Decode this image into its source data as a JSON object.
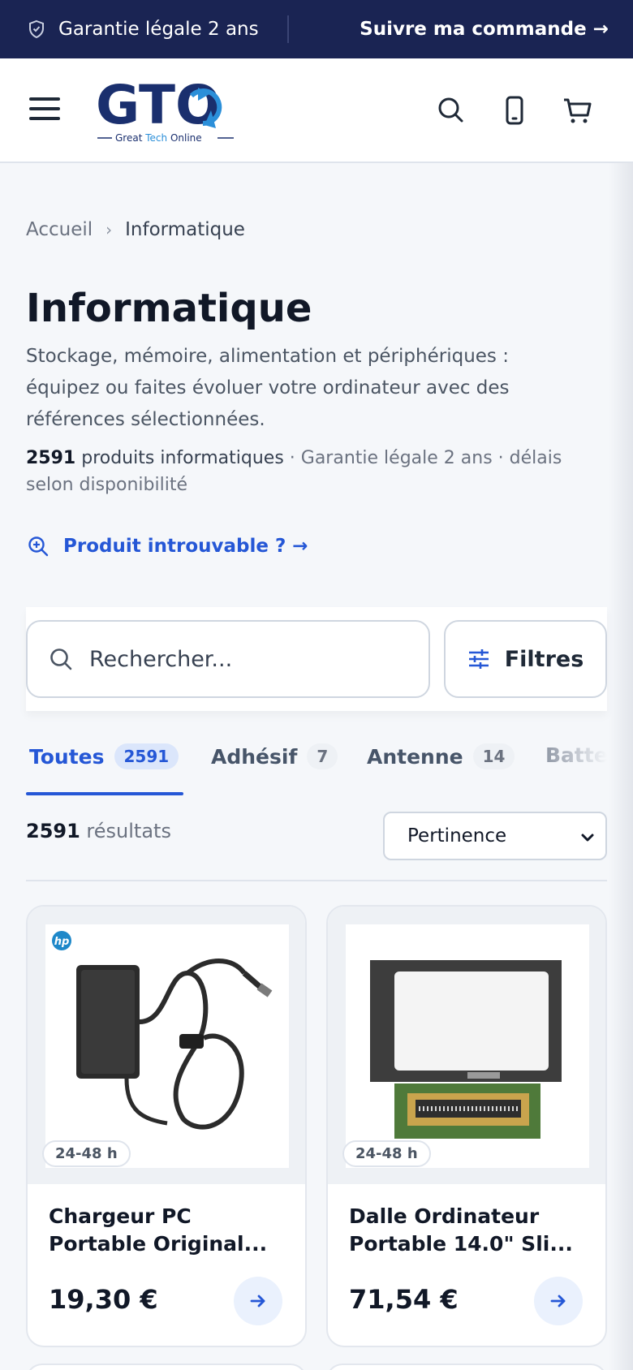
{
  "topbar": {
    "guarantee": "Garantie légale 2 ans",
    "track_order": "Suivre ma commande →"
  },
  "header": {
    "logo_text": "GTO",
    "logo_tagline_a": "Great ",
    "logo_tagline_b": "Tech",
    "logo_tagline_c": " Online",
    "icons": [
      "menu-icon",
      "search-icon",
      "phone-icon",
      "cart-icon"
    ]
  },
  "breadcrumb": {
    "home": "Accueil",
    "separator": "›",
    "current": "Informatique"
  },
  "page": {
    "title": "Informatique",
    "description": "Stockage, mémoire, alimentation et périphériques : équipez ou faites évoluer votre ordinateur avec des références sélectionnées.",
    "stats_count": "2591",
    "stats_label": " produits informatiques",
    "stats_extra": " · Garantie légale 2 ans · délais selon disponibilité",
    "not_found_link": "Produit introuvable ?  →"
  },
  "search": {
    "placeholder": "Rechercher...",
    "filters_label": "Filtres"
  },
  "tabs": [
    {
      "label": "Toutes",
      "count": "2591",
      "active": true
    },
    {
      "label": "Adhésif",
      "count": "7",
      "active": false
    },
    {
      "label": "Antenne",
      "count": "14",
      "active": false
    },
    {
      "label": "Batterie",
      "count": "",
      "active": false
    }
  ],
  "results": {
    "count": "2591",
    "label": " résultats",
    "sort_selected": "Pertinence"
  },
  "products": [
    {
      "delivery": "24-48 h",
      "name_line1": "Chargeur PC",
      "name_line2": "Portable Original...",
      "price": "19,30 €",
      "brand_badge": "hp"
    },
    {
      "delivery": "24-48 h",
      "name_line1": "Dalle Ordinateur",
      "name_line2": "Portable 14.0\" Sli...",
      "price": "71,54 €"
    }
  ],
  "colors": {
    "topbar_bg": "#1a2453",
    "accent": "#2557d6",
    "logo_navy": "#1a2f6e",
    "logo_blue": "#2b8fd9"
  }
}
